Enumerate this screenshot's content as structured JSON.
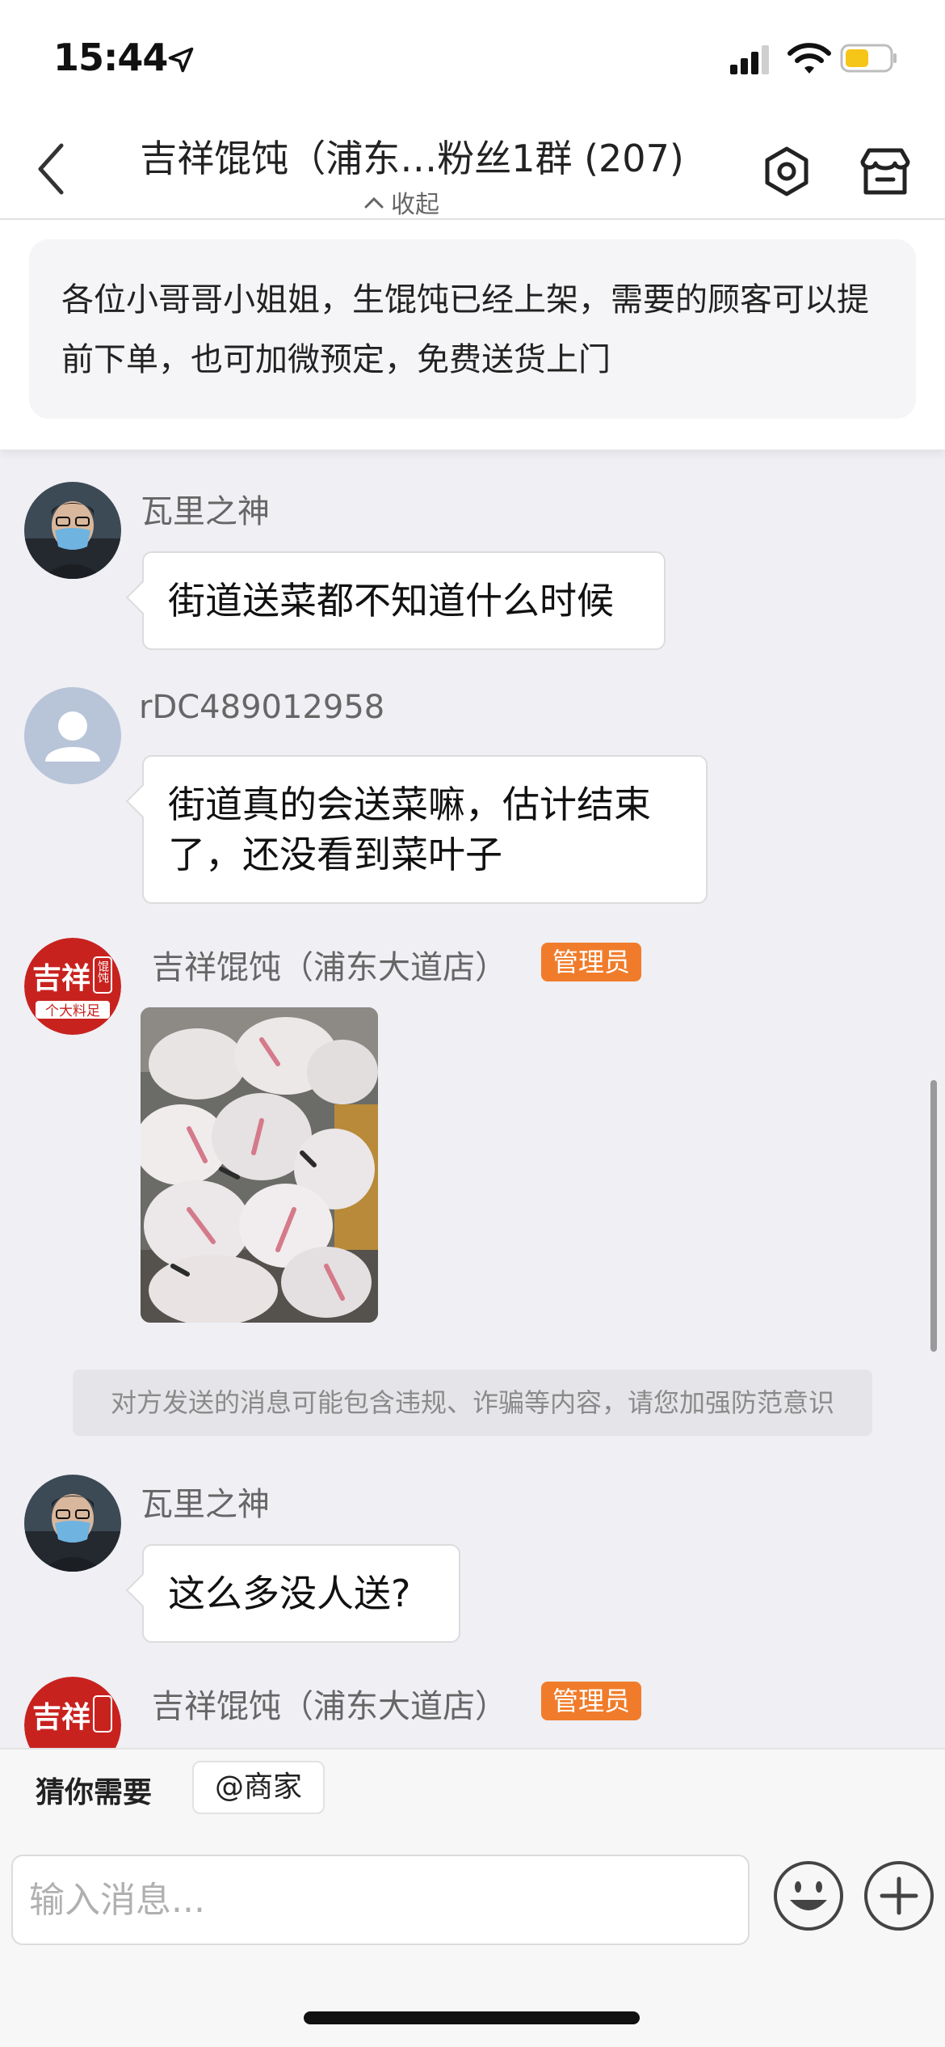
{
  "status_bar": {
    "time": "15:44"
  },
  "nav": {
    "title": "吉祥馄饨（浦东…粉丝1群 (207)",
    "collapse_label": "收起"
  },
  "notice": {
    "text": "各位小哥哥小姐姐，生馄饨已经上架，需要的顾客可以提前下单，也可加微预定，免费送货上门"
  },
  "messages": [
    {
      "sender": "瓦里之神",
      "text": "街道送菜都不知道什么时候"
    },
    {
      "sender": "rDC489012958",
      "text": "街道真的会送菜嘛，估计结束了，还没看到菜叶子"
    },
    {
      "sender": "吉祥馄饨（浦东大道店）",
      "badge": "管理员",
      "type": "image"
    },
    {
      "sender": "瓦里之神",
      "text": "这么多没人送?"
    },
    {
      "sender": "吉祥馄饨（浦东大道店）",
      "badge": "管理员"
    }
  ],
  "warning": "对方发送的消息可能包含违规、诈骗等内容，请您加强防范意识",
  "logo": {
    "brand": "吉祥",
    "side": "馄饨",
    "tag": "个大料足"
  },
  "input": {
    "guess_label": "猜你需要",
    "chip_label": "@商家",
    "placeholder": "输入消息..."
  },
  "colors": {
    "admin_badge": "#f07c2b",
    "logo_red": "#c8221f"
  }
}
